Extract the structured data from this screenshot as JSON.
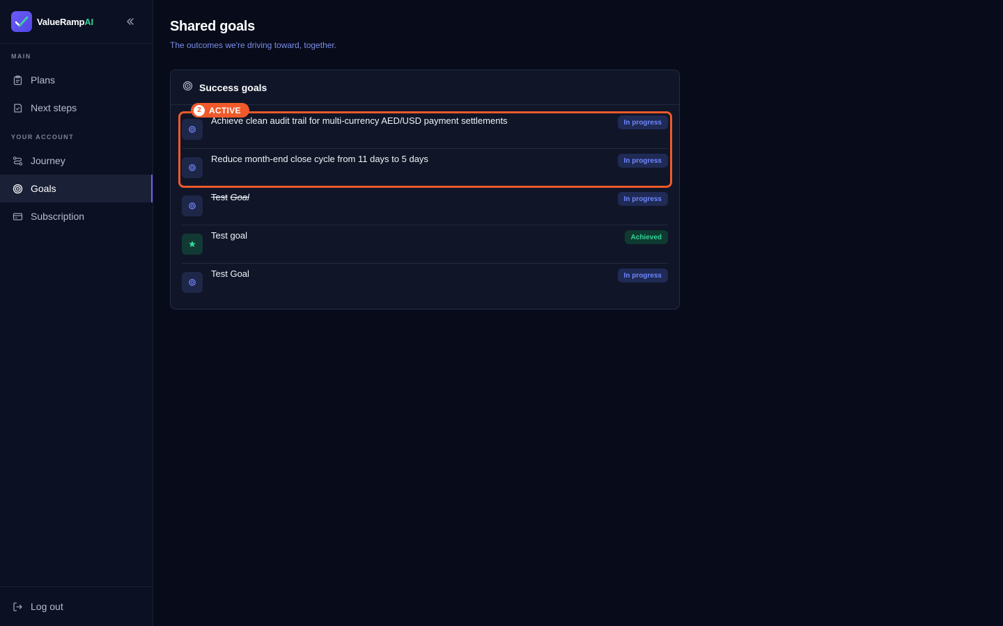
{
  "brand": {
    "name": "ValueRamp",
    "suffix": "AI"
  },
  "sidebar": {
    "section_main": "MAIN",
    "section_account": "YOUR ACCOUNT",
    "items": [
      {
        "label": "Plans",
        "icon": "clipboard-icon"
      },
      {
        "label": "Next steps",
        "icon": "checklist-icon"
      },
      {
        "label": "Journey",
        "icon": "route-icon"
      },
      {
        "label": "Goals",
        "icon": "target-icon",
        "active": true
      },
      {
        "label": "Subscription",
        "icon": "credit-card-icon"
      }
    ],
    "logout": "Log out"
  },
  "page": {
    "title": "Shared goals",
    "subtitle": "The outcomes we're driving toward, together."
  },
  "card": {
    "title": "Success goals",
    "goals": [
      {
        "text": "Achieve clean audit trail for multi-currency AED/USD payment settlements",
        "status": "In progress"
      },
      {
        "text": "Reduce month-end close cycle from 11 days to 5 days",
        "status": "In progress"
      },
      {
        "text_part1": "Test",
        "text_part2": "Goal",
        "status": "In progress"
      },
      {
        "text": "Test goal",
        "status": "Achieved"
      },
      {
        "text": "Test Goal",
        "status": "In progress"
      }
    ]
  },
  "highlight": {
    "number": "2",
    "label": "ACTIVE"
  },
  "colors": {
    "accent": "#6d5cf6",
    "highlight": "#f0592a",
    "progress": "#6f86ff",
    "achieved": "#34d399"
  }
}
